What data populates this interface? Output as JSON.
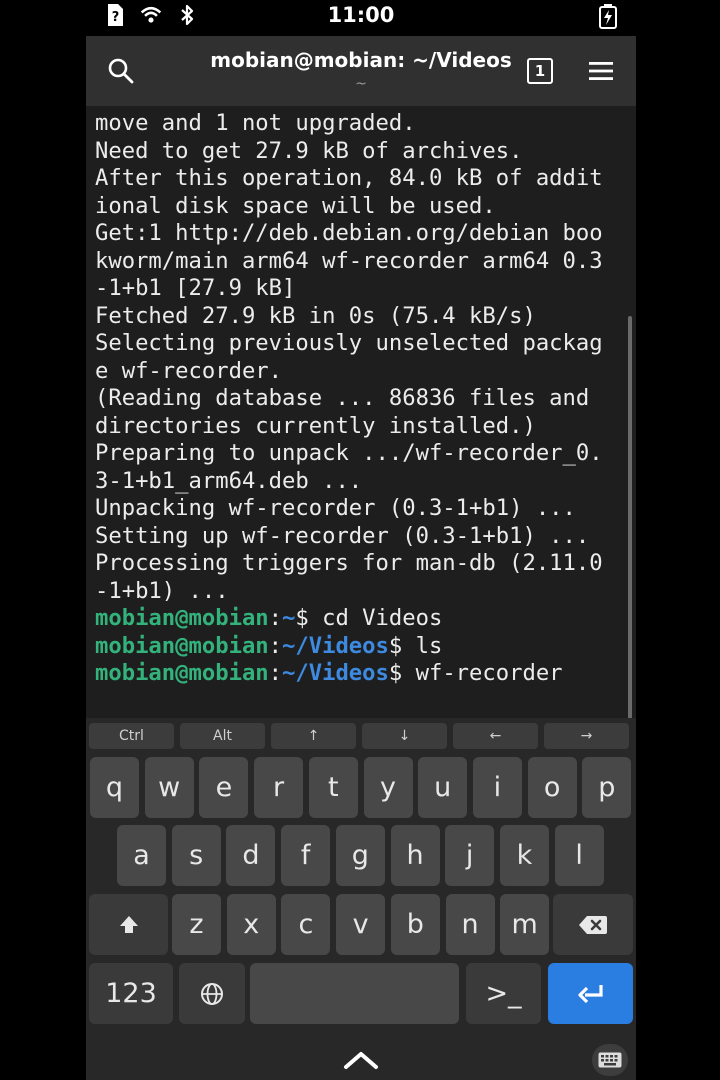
{
  "status_bar": {
    "time": "11:00",
    "icons": [
      "sim-unknown-icon",
      "wifi-icon",
      "bluetooth-icon"
    ],
    "battery_icon": "battery-charging-icon"
  },
  "header": {
    "title": "mobian@mobian: ~/Videos",
    "subtitle": "~",
    "tab_count": "1"
  },
  "terminal": {
    "lines": [
      "move and 1 not upgraded.",
      "Need to get 27.9 kB of archives.",
      "After this operation, 84.0 kB of addit",
      "ional disk space will be used.",
      "Get:1 http://deb.debian.org/debian boo",
      "kworm/main arm64 wf-recorder arm64 0.3",
      "-1+b1 [27.9 kB]",
      "Fetched 27.9 kB in 0s (75.4 kB/s)",
      "Selecting previously unselected packag",
      "e wf-recorder.",
      "(Reading database ... 86836 files and",
      "directories currently installed.)",
      "Preparing to unpack .../wf-recorder_0.",
      "3-1+b1_arm64.deb ...",
      "Unpacking wf-recorder (0.3-1+b1) ...",
      "Setting up wf-recorder (0.3-1+b1) ...",
      "Processing triggers for man-db (2.11.0",
      "-1+b1) ..."
    ],
    "prompts": [
      {
        "user": "mobian@mobian",
        "sep": ":",
        "path": "~",
        "cmd": "$ cd Videos"
      },
      {
        "user": "mobian@mobian",
        "sep": ":",
        "path": "~/Videos",
        "cmd": "$ ls"
      },
      {
        "user": "mobian@mobian",
        "sep": ":",
        "path": "~/Videos",
        "cmd": "$ wf-recorder"
      }
    ]
  },
  "keyboard": {
    "modifiers": [
      "Ctrl",
      "Alt",
      "↑",
      "↓",
      "←",
      "→"
    ],
    "row1": [
      "q",
      "w",
      "e",
      "r",
      "t",
      "y",
      "u",
      "i",
      "o",
      "p"
    ],
    "row2": [
      "a",
      "s",
      "d",
      "f",
      "g",
      "h",
      "j",
      "k",
      "l"
    ],
    "row3": [
      "z",
      "x",
      "c",
      "v",
      "b",
      "n",
      "m"
    ],
    "numbers_label": "123",
    "terminal_key_label": ">_",
    "accent_color": "#2a7de1"
  }
}
